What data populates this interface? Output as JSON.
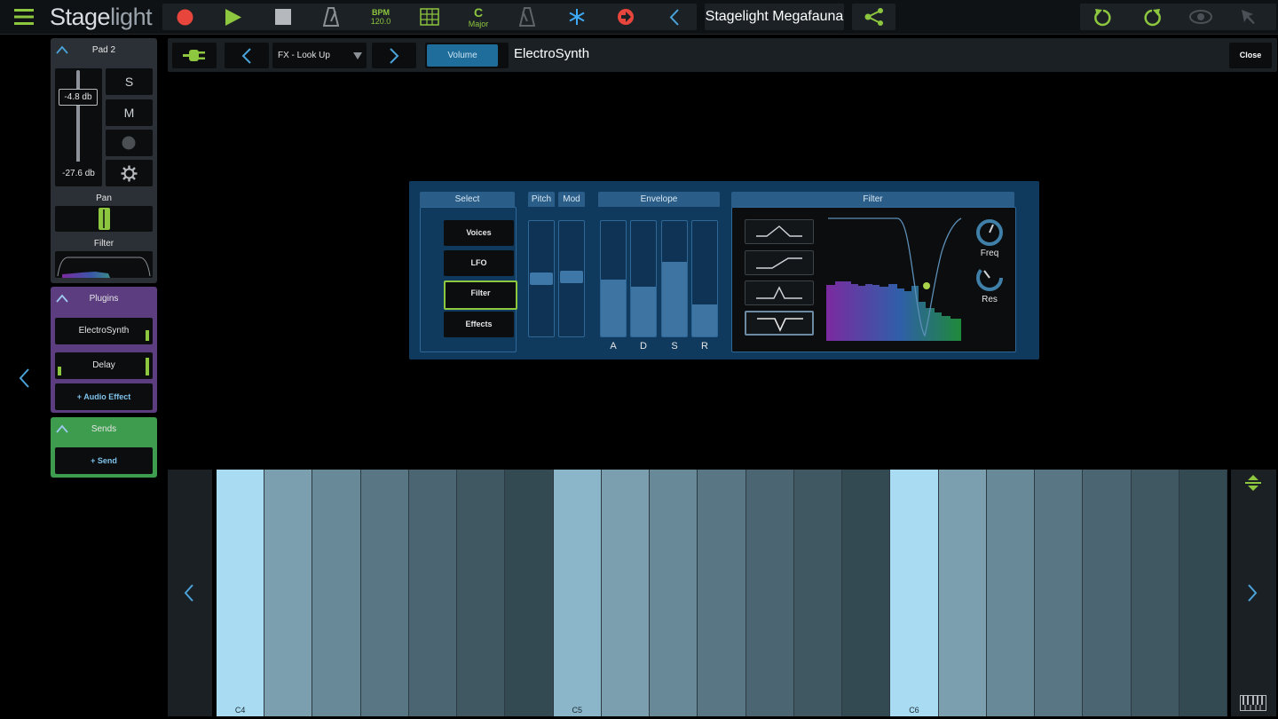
{
  "app": {
    "logo_main": "Stage",
    "logo_light": "light",
    "bpm_label": "BPM",
    "bpm_value": "120.0",
    "key_root": "C",
    "key_mode": "Major",
    "project_name": "Stagelight Megafauna"
  },
  "track": {
    "name": "Pad 2",
    "volume_db": "-4.8 db",
    "peak_db": "-27.6 db",
    "solo_label": "S",
    "mute_label": "M",
    "pan_label": "Pan",
    "filter_label": "Filter",
    "volume_level": 0.34,
    "pan_value": 0.5
  },
  "plugins": {
    "title": "Plugins",
    "items": [
      "ElectroSynth",
      "Delay"
    ],
    "add_label": "+ Audio Effect"
  },
  "sends": {
    "title": "Sends",
    "add_label": "+ Send"
  },
  "device": {
    "preset": "FX - Look Up",
    "tab": "Volume",
    "name": "ElectroSynth",
    "close_label": "Close"
  },
  "synth": {
    "select": {
      "title": "Select",
      "buttons": [
        "Voices",
        "LFO",
        "Filter",
        "Effects"
      ],
      "active": "Filter"
    },
    "pitch_label": "Pitch",
    "mod_label": "Mod",
    "pitch_value": 0.5,
    "mod_value": 0.52,
    "envelope": {
      "title": "Envelope",
      "labels": [
        "A",
        "D",
        "S",
        "R"
      ],
      "values": [
        0.49,
        0.43,
        0.65,
        0.28
      ]
    },
    "filter": {
      "title": "Filter",
      "types": [
        "low-pass",
        "high-pass",
        "band-pass",
        "notch"
      ],
      "active_type": "notch",
      "freq_label": "Freq",
      "res_label": "Res"
    }
  },
  "keyboard": {
    "labels": [
      "C4",
      "C5",
      "C6"
    ]
  },
  "colors": {
    "accent": "#8dc63f",
    "record": "#e8453c",
    "blue": "#2a5d87",
    "plugins": "#5b3d80",
    "sends": "#3d9c4e"
  }
}
